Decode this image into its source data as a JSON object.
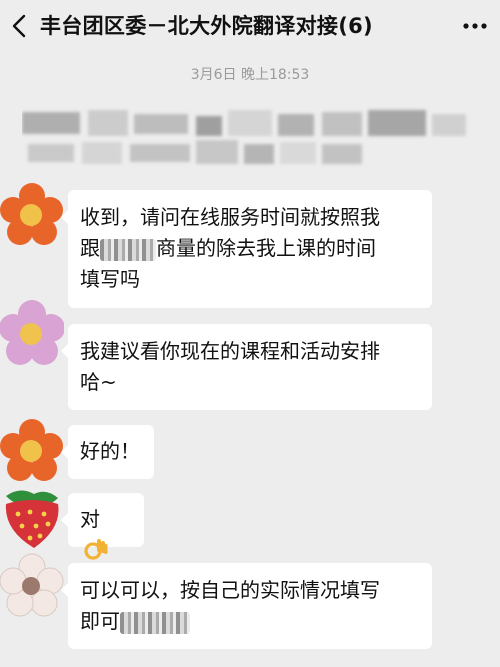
{
  "header": {
    "title": "丰台团区委－北大外院翻译对接(6)",
    "back_icon": "chevron-left-icon",
    "more_icon": "more-dots-icon"
  },
  "timestamp": "3月6日 晚上18:53",
  "messages": [
    {
      "avatar": "orange-flower-avatar",
      "line1": "收到，请问在线服务时间就按照我",
      "line2_start": "跟",
      "line2_end": "商量的除去我上课的时间",
      "line3": "填写吗"
    },
    {
      "avatar": "pink-flower-avatar",
      "line1": "我建议看你现在的课程和活动安排",
      "line2": "哈~"
    },
    {
      "avatar": "orange-flower-avatar",
      "text": "好的！"
    },
    {
      "avatar": "strawberry-avatar",
      "text": "对",
      "emoji": "ok-hand-icon"
    },
    {
      "avatar": "white-flower-avatar",
      "line1": "可以可以，按自己的实际情况填写",
      "line2": "即可"
    }
  ],
  "colors": {
    "background": "#ededed",
    "bubble": "#ffffff",
    "timestamp": "#9a9a9a"
  }
}
